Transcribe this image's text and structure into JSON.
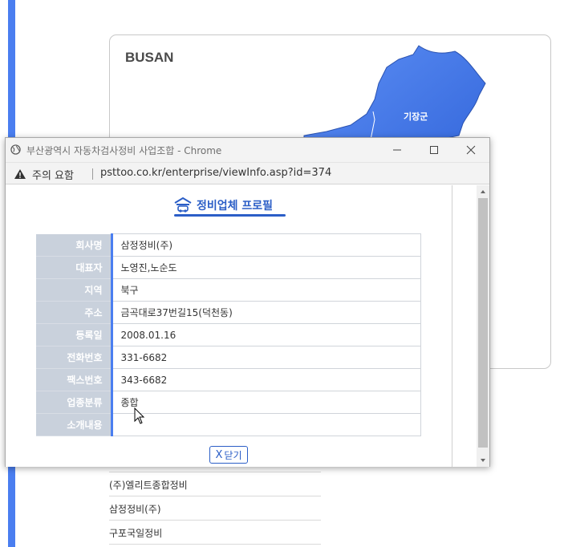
{
  "background": {
    "map_title": "BUSAN",
    "region_label": "기장군",
    "list_items": [
      "(주)엘리트종합정비",
      "삼정정비(주)",
      "구포국일정비"
    ]
  },
  "window": {
    "title": "부산광역시 자동차검사정비 사업조합 - Chrome",
    "warning_text": "주의 요함",
    "url": "psttoo.co.kr/enterprise/viewInfo.asp?id=374"
  },
  "profile": {
    "heading": "정비업체 프로필",
    "fields": [
      {
        "label": "회사명",
        "value": "삼정정비(주)"
      },
      {
        "label": "대표자",
        "value": "노영진,노순도"
      },
      {
        "label": "지역",
        "value": "북구"
      },
      {
        "label": "주소",
        "value": "금곡대로37번길15(덕천동)"
      },
      {
        "label": "등록일",
        "value": "2008.01.16"
      },
      {
        "label": "전화번호",
        "value": "331-6682"
      },
      {
        "label": "팩스번호",
        "value": "343-6682"
      },
      {
        "label": "업종분류",
        "value": "종합"
      },
      {
        "label": "소개내용",
        "value": ""
      }
    ],
    "close_label": "닫기",
    "close_icon": "X"
  },
  "colors": {
    "accent": "#2b5ec7",
    "map_fill": "#4a7ef0",
    "label_bg": "#c9d1dc"
  }
}
